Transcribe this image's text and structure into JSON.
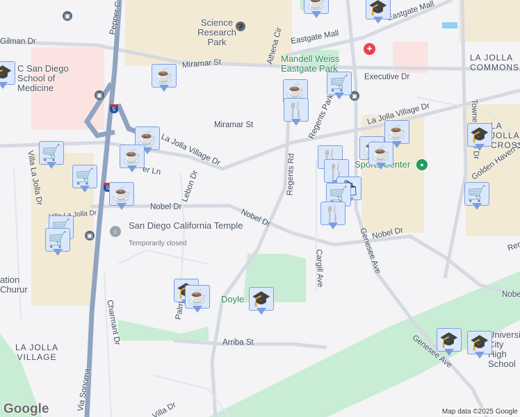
{
  "map": {
    "streets": [
      "Gilman Dr",
      "Pepper C",
      "Miramar St",
      "Miramar St",
      "La Jolla Village Dr",
      "Villa La Jolla Dr",
      "Lebon Dr",
      "Nobel Dr",
      "Nobel Dr",
      "Nobel Dr",
      "Athena Cir",
      "Eastgate Mall",
      "Eastgate Mall",
      "Executive Dr",
      "Regents Park Row",
      "La Jolla Village Dr",
      "Regents Rd",
      "Towne Centre Dr",
      "Golden Haven Dr",
      "Cargill Ave",
      "Genesee Ave",
      "Genesee Ave",
      "Charmant Dr",
      "Palmilla",
      "Arriba St",
      "Via Sonoma",
      "Villa Dr",
      "Nobel",
      "Rem",
      "Villa La Jolla Dr",
      "er Ln",
      "Univ"
    ],
    "pois": {
      "science_research_park": "Science Research Park",
      "ucsd_medicine": "C San Diego School of Medicine",
      "mandell_weiss": "Mandell Weiss Eastgate Park",
      "sports_center": "Sports Center",
      "temple": "San Diego California Temple",
      "temple_status": "Temporarily closed",
      "doyle": "Doyle",
      "university_city_hs": "University City High School",
      "church": "ation Churun"
    },
    "areas": [
      "LA JOLLA COMMONS",
      "LA JOLLA CROSSROADS",
      "LA JOLLA VILLAGE"
    ],
    "highway_shield": "5",
    "attribution": "Map data ©2025 Google",
    "logo": "Google",
    "colors": {
      "marker_bg": "#dbe7fb",
      "marker_border": "#7c9ee0",
      "icon": "#0e3a5f",
      "park": "#c8ecd4",
      "commercial": "#f3ead6",
      "hospital_area": "#fbe3e1",
      "road": "#d5dae2",
      "freeway": "#8fa4c0"
    }
  }
}
